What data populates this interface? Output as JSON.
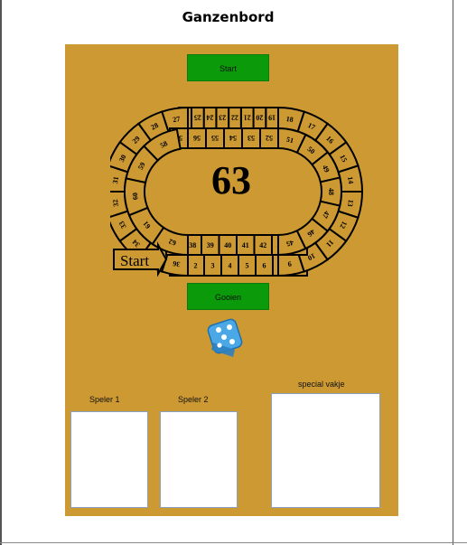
{
  "page": {
    "title": "Ganzenbord"
  },
  "controls": {
    "start_label": "Start",
    "roll_label": "Gooien"
  },
  "board": {
    "center_number": "63",
    "start_text": "Start",
    "squares": [
      "1",
      "2",
      "3",
      "4",
      "5",
      "6",
      "7",
      "8",
      "9",
      "10",
      "11",
      "12",
      "13",
      "14",
      "15",
      "16",
      "17",
      "18",
      "19",
      "20",
      "21",
      "22",
      "23",
      "24",
      "25",
      "26",
      "27",
      "28",
      "29",
      "30",
      "31",
      "32",
      "33",
      "34",
      "35",
      "36",
      "37",
      "38",
      "39",
      "40",
      "41",
      "42",
      "43",
      "44",
      "45",
      "46",
      "47",
      "48",
      "49",
      "50",
      "51",
      "52",
      "53",
      "54",
      "55",
      "56",
      "57",
      "58",
      "59",
      "60",
      "61",
      "62"
    ]
  },
  "players": [
    {
      "label": "Speler 1"
    },
    {
      "label": "Speler 2"
    }
  ],
  "special": {
    "label": "special vakje"
  }
}
